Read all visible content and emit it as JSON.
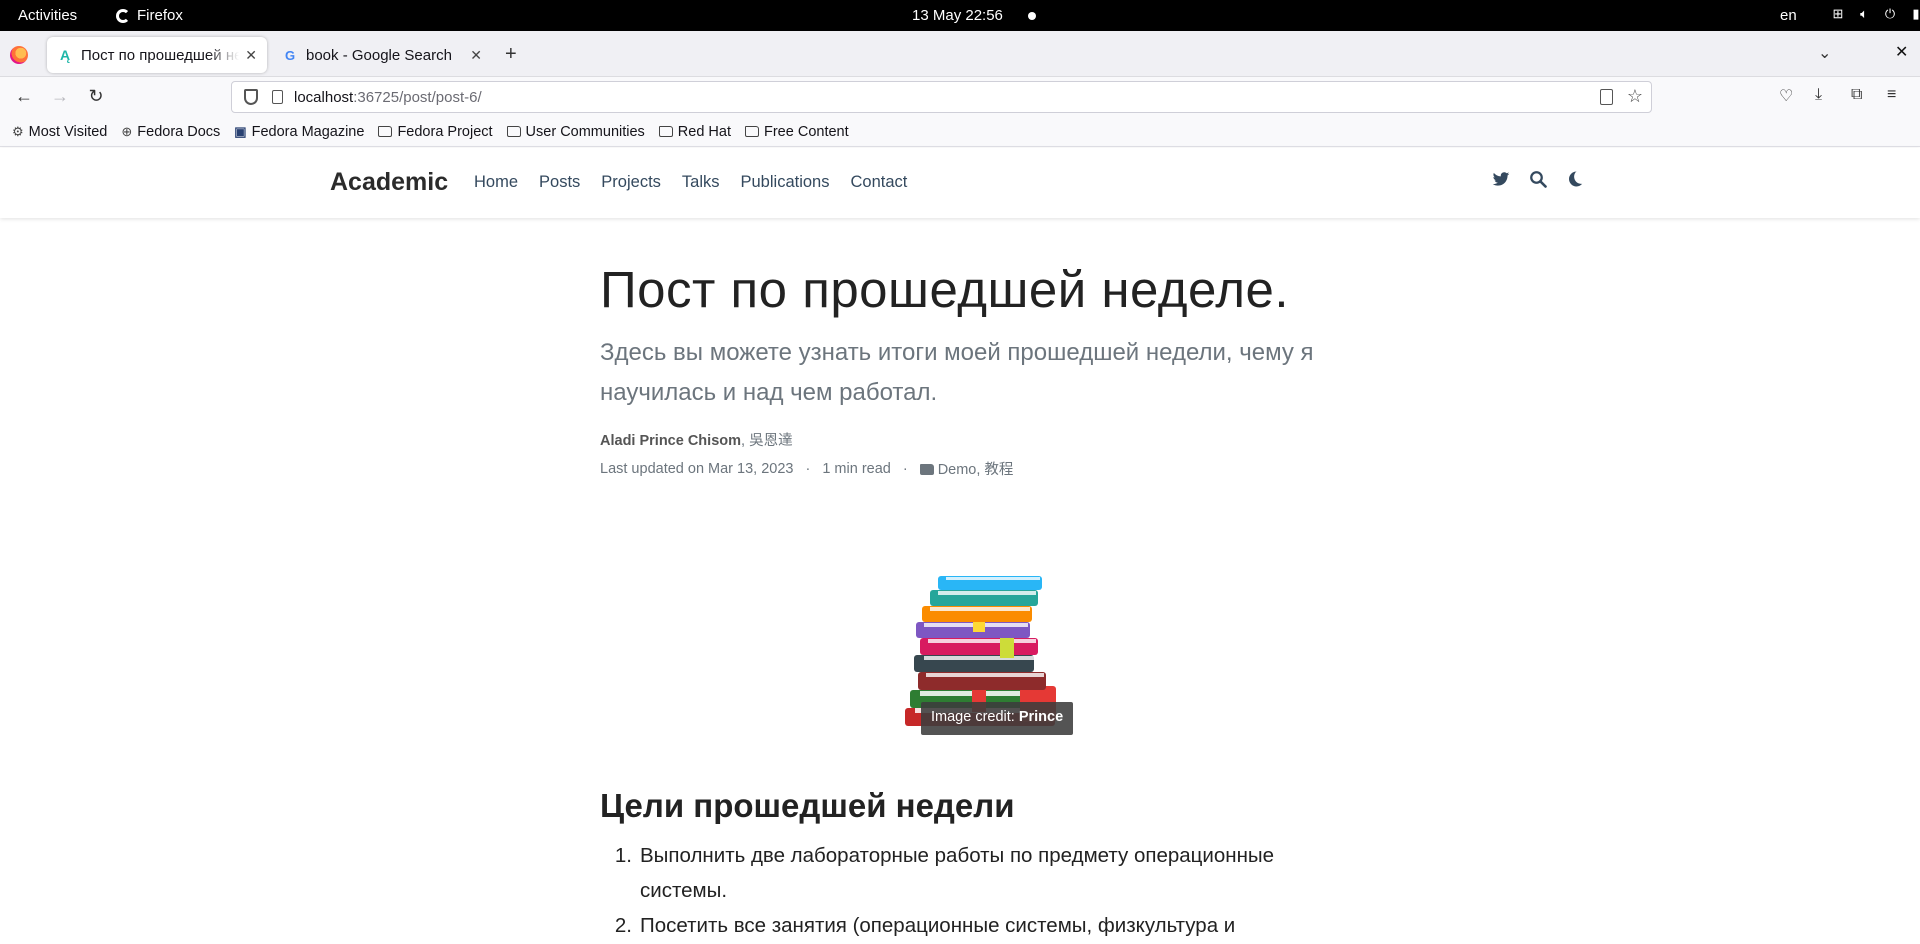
{
  "system": {
    "activities": "Activities",
    "app_name": "Firefox",
    "clock": "13 May  22:56",
    "language": "en"
  },
  "browser": {
    "tabs": [
      {
        "title": "Пост по прошедшей неделе.",
        "active": true,
        "favicon": "academic-favicon"
      },
      {
        "title": "book - Google Search",
        "active": false,
        "favicon": "google-favicon"
      }
    ],
    "url": {
      "host": "localhost",
      "rest": ":36725/post/post-6/"
    },
    "bookmarks": [
      {
        "label": "Most Visited",
        "icon": "gear-icon"
      },
      {
        "label": "Fedora Docs",
        "icon": "globe-icon"
      },
      {
        "label": "Fedora Magazine",
        "icon": "fedora-magazine-icon"
      },
      {
        "label": "Fedora Project",
        "icon": "folder-icon"
      },
      {
        "label": "User Communities",
        "icon": "folder-icon"
      },
      {
        "label": "Red Hat",
        "icon": "folder-icon"
      },
      {
        "label": "Free Content",
        "icon": "folder-icon"
      }
    ]
  },
  "site": {
    "brand": "Academic",
    "menu": [
      "Home",
      "Posts",
      "Projects",
      "Talks",
      "Publications",
      "Contact"
    ]
  },
  "post": {
    "title": "Пост по прошедшей неделе.",
    "lead": "Здесь вы можете узнать итоги моей прошедшей недели, чему я научилась и над чем работал.",
    "author_main": "Aladi Prince Chisom",
    "author_rest": ", 吳恩達",
    "updated": "Last updated on Mar 13, 2023",
    "read_time": "1 min read",
    "separator": "·",
    "categories": "Demo, 教程",
    "image_credit_label": "Image credit: ",
    "image_credit_name": "Prince",
    "section_heading": "Цели прошедшей недели",
    "goals": [
      {
        "num": "1.",
        "text": "Выполнить две лабораторные работы по предмету операционные системы."
      },
      {
        "num": "2.",
        "text": "Посетить все занятия (операционные системы, физкультура и"
      }
    ]
  }
}
